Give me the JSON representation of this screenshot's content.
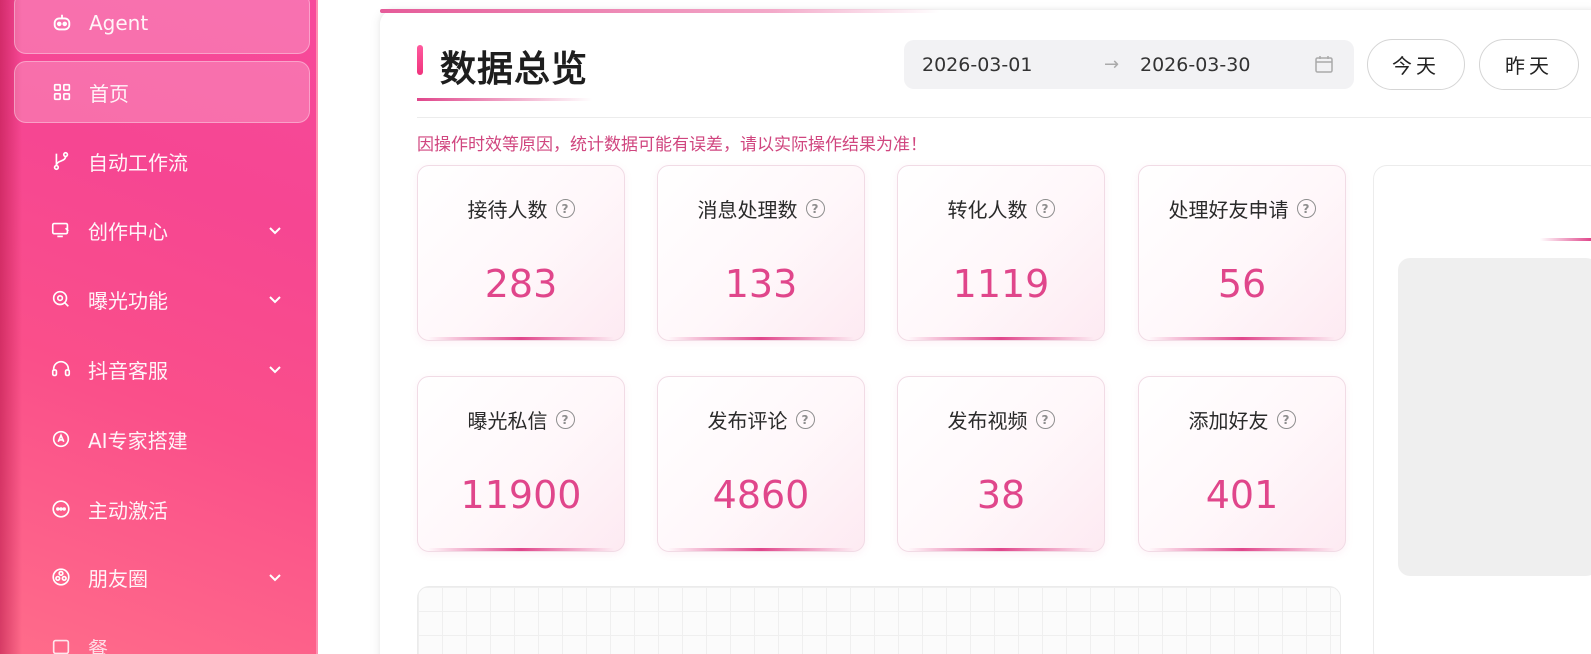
{
  "sidebar": {
    "items": [
      {
        "label": "Agent",
        "icon": "robot-icon",
        "active": true
      },
      {
        "label": "首页",
        "icon": "grid-icon",
        "active": true
      },
      {
        "label": "自动工作流",
        "icon": "branch-icon",
        "expandable": false
      },
      {
        "label": "创作中心",
        "icon": "monitor-pen-icon",
        "expandable": true
      },
      {
        "label": "曝光功能",
        "icon": "eye-search-icon",
        "expandable": true
      },
      {
        "label": "抖音客服",
        "icon": "headset-icon",
        "expandable": true
      },
      {
        "label": "AI专家搭建",
        "icon": "ai-build-icon",
        "expandable": false
      },
      {
        "label": "主动激活",
        "icon": "chat-bubble-icon",
        "expandable": false
      },
      {
        "label": "朋友圈",
        "icon": "aperture-icon",
        "expandable": true
      },
      {
        "label": "餐",
        "icon": "partial-icon",
        "expandable": false
      }
    ]
  },
  "header": {
    "title": "数据总览",
    "date_start": "2026-03-01",
    "date_separator": "→",
    "date_end": "2026-03-30",
    "btn_today": "今天",
    "btn_yesterday": "昨天"
  },
  "notice": "因操作时效等原因，统计数据可能有误差，请以实际操作结果为准！",
  "stats": [
    {
      "label": "接待人数",
      "value": "283"
    },
    {
      "label": "消息处理数",
      "value": "133"
    },
    {
      "label": "转化人数",
      "value": "1119"
    },
    {
      "label": "处理好友申请",
      "value": "56"
    },
    {
      "label": "曝光私信",
      "value": "11900"
    },
    {
      "label": "发布评论",
      "value": "4860"
    },
    {
      "label": "发布视频",
      "value": "38"
    },
    {
      "label": "添加好友",
      "value": "401"
    }
  ],
  "help_glyph": "?",
  "colors": {
    "accent": "#e0468b",
    "sidebar_top": "#f74a9b",
    "sidebar_bottom": "#ff6c8a",
    "notice": "#d0467f"
  }
}
